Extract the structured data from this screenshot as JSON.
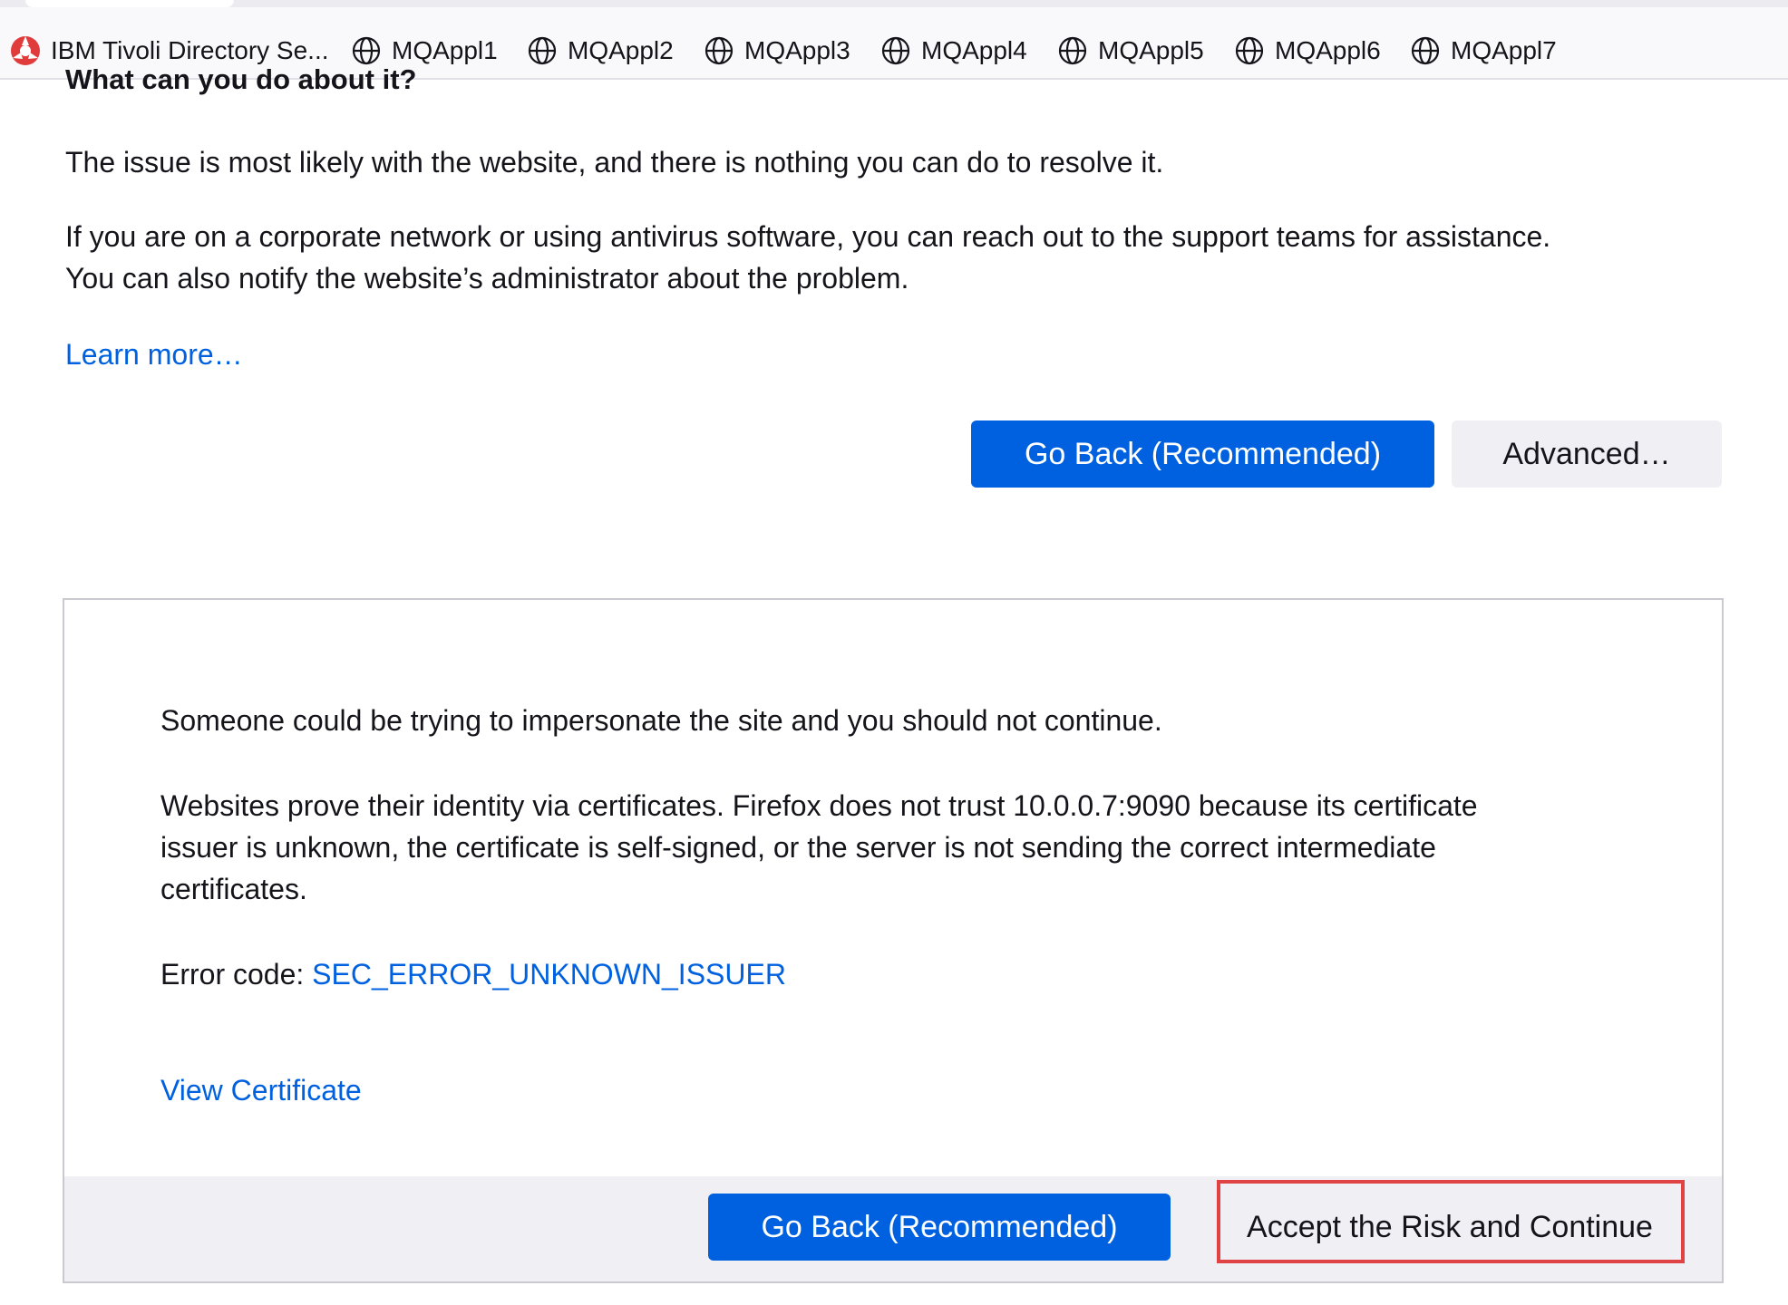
{
  "bookmarks": [
    {
      "label": "IBM Tivoli Directory Se...",
      "icon": "ibm-tivoli-icon"
    },
    {
      "label": "MQAppl1",
      "icon": "globe-icon"
    },
    {
      "label": "MQAppl2",
      "icon": "globe-icon"
    },
    {
      "label": "MQAppl3",
      "icon": "globe-icon"
    },
    {
      "label": "MQAppl4",
      "icon": "globe-icon"
    },
    {
      "label": "MQAppl5",
      "icon": "globe-icon"
    },
    {
      "label": "MQAppl6",
      "icon": "globe-icon"
    },
    {
      "label": "MQAppl7",
      "icon": "globe-icon"
    }
  ],
  "main": {
    "heading": "What can you do about it?",
    "para1": "The issue is most likely with the website, and there is nothing you can do to resolve it.",
    "para2_line1": "If you are on a corporate network or using antivirus software, you can reach out to the support teams for assistance.",
    "para2_line2": "You can also notify the website’s administrator about the problem.",
    "learn_more": "Learn more…",
    "go_back_label": "Go Back (Recommended)",
    "advanced_label": "Advanced…"
  },
  "advanced": {
    "warning": "Someone could be trying to impersonate the site and you should not continue.",
    "cert_line1": "Websites prove their identity via certificates. Firefox does not trust 10.0.0.7:9090 because its certificate",
    "cert_line2": "issuer is unknown, the certificate is self-signed, or the server is not sending the correct intermediate",
    "cert_line3": "certificates.",
    "error_code_prefix": "Error code: ",
    "error_code": "SEC_ERROR_UNKNOWN_ISSUER",
    "view_certificate": "View Certificate",
    "go_back_label": "Go Back (Recommended)",
    "accept_label": "Accept the Risk and Continue"
  },
  "colors": {
    "accent": "#0061e0",
    "highlight": "#e04343"
  }
}
